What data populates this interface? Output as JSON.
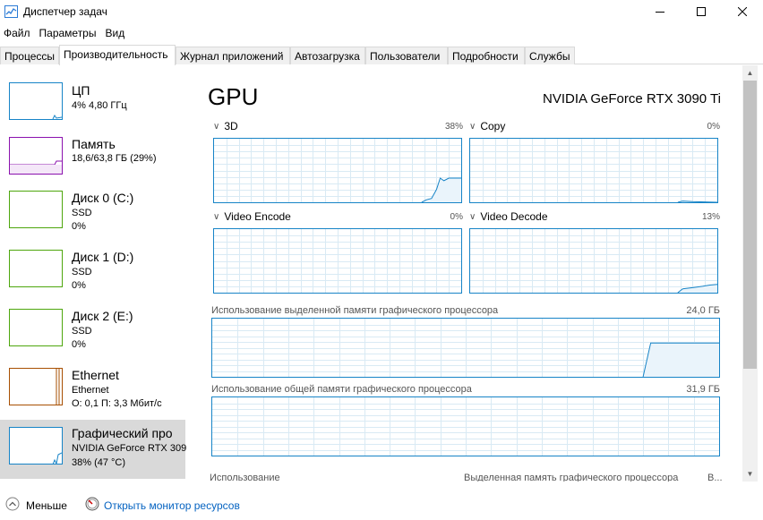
{
  "window": {
    "title": "Диспетчер задач"
  },
  "menu": [
    "Файл",
    "Параметры",
    "Вид"
  ],
  "tabs": [
    {
      "label": "Процессы"
    },
    {
      "label": "Производительность"
    },
    {
      "label": "Журнал приложений"
    },
    {
      "label": "Автозагрузка"
    },
    {
      "label": "Пользователи"
    },
    {
      "label": "Подробности"
    },
    {
      "label": "Службы"
    }
  ],
  "sidebar": [
    {
      "title": "ЦП",
      "sub1": "4% 4,80 ГГц",
      "sub2": "",
      "color": "#1784c7"
    },
    {
      "title": "Память",
      "sub1": "18,6/63,8 ГБ (29%)",
      "sub2": "",
      "color": "#8b12ae"
    },
    {
      "title": "Диск 0 (C:)",
      "sub1": "SSD",
      "sub2": "0%",
      "color": "#4da60c"
    },
    {
      "title": "Диск 1 (D:)",
      "sub1": "SSD",
      "sub2": "0%",
      "color": "#4da60c"
    },
    {
      "title": "Диск 2 (E:)",
      "sub1": "SSD",
      "sub2": "0%",
      "color": "#4da60c"
    },
    {
      "title": "Ethernet",
      "sub1": "Ethernet",
      "sub2": "О: 0,1 П: 3,3 Мбит/с",
      "color": "#a74f01"
    },
    {
      "title": "Графический про",
      "sub1": "NVIDIA GeForce RTX 309",
      "sub2": "38% (47 °C)",
      "color": "#1784c7"
    }
  ],
  "gpu": {
    "title": "GPU",
    "model": "NVIDIA GeForce RTX 3090 Ti",
    "engines": [
      {
        "label": "3D",
        "pct": "38%",
        "value": 38
      },
      {
        "label": "Copy",
        "pct": "0%",
        "value": 0
      },
      {
        "label": "Video Encode",
        "pct": "0%",
        "value": 0
      },
      {
        "label": "Video Decode",
        "pct": "13%",
        "value": 13
      }
    ],
    "dedicated": {
      "label": "Использование выделенной памяти графического процессора",
      "value": "24,0 ГБ"
    },
    "shared": {
      "label": "Использование общей памяти графического процессора",
      "value": "31,9 ГБ"
    },
    "bottom": {
      "left": "Использование",
      "right": "Выделенная память графического процессора",
      "right_trunc": "В..."
    }
  },
  "footer": {
    "fewer": "Меньше",
    "monitor": "Открыть монитор ресурсов"
  },
  "colors": {
    "accent": "#1784c7",
    "memory": "#8b12ae",
    "disk": "#4da60c",
    "ethernet": "#a74f01"
  }
}
